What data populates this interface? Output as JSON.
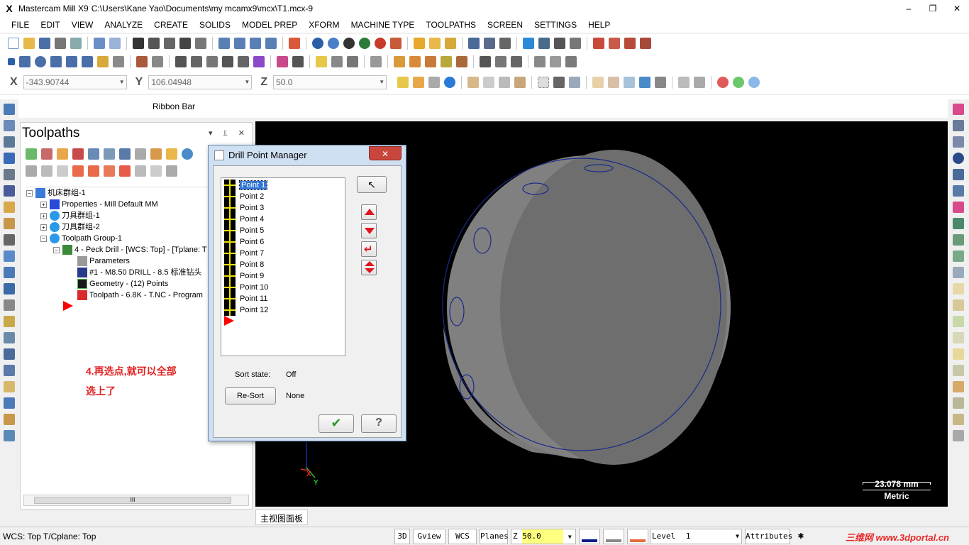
{
  "titlebar": {
    "app_name": "Mastercam Mill X9",
    "path": "C:\\Users\\Kane Yao\\Documents\\my mcamx9\\mcx\\T1.mcx-9",
    "minimize": "–",
    "restore": "❐",
    "close": "✕"
  },
  "menu": [
    "FILE",
    "EDIT",
    "VIEW",
    "ANALYZE",
    "CREATE",
    "SOLIDS",
    "MODEL PREP",
    "XFORM",
    "MACHINE TYPE",
    "TOOLPATHS",
    "SCREEN",
    "SETTINGS",
    "HELP"
  ],
  "coords": {
    "x_label": "X",
    "x_value": "-343.90744",
    "y_label": "Y",
    "y_value": "106.04948",
    "z_label": "Z",
    "z_value": "50.0"
  },
  "ribbon_bar": "Ribbon Bar",
  "toolpaths": {
    "title": "Toolpaths",
    "controls": "▾ ⫫ ✕",
    "tree": [
      {
        "label": "机床群组-1",
        "expander": "−"
      },
      {
        "label": "Properties - Mill Default MM",
        "expander": "+"
      },
      {
        "label": "刀具群组-1",
        "expander": "+"
      },
      {
        "label": "刀具群组-2",
        "expander": "+"
      },
      {
        "label": "Toolpath Group-1",
        "expander": "−"
      },
      {
        "label": "4 - Peck Drill - [WCS: Top] - [Tplane: T",
        "expander": "−"
      },
      {
        "label": "Parameters",
        "expander": ""
      },
      {
        "label": "#1 - M8.50 DRILL - 8.5 标准钻头",
        "expander": ""
      },
      {
        "label": "Geometry - (12) Points",
        "expander": ""
      },
      {
        "label": "Toolpath - 6.8K - T.NC - Program",
        "expander": ""
      }
    ],
    "annotation_line1": "4.再选点,就可以全部",
    "annotation_line2": "选上了",
    "scroll_thumb": "III"
  },
  "dialog": {
    "title": "Drill Point Manager",
    "close": "✕",
    "points": [
      "Point 1",
      "Point 2",
      "Point 3",
      "Point 4",
      "Point 5",
      "Point 6",
      "Point 7",
      "Point 8",
      "Point 9",
      "Point 10",
      "Point 11",
      "Point 12"
    ],
    "selected_point": "Point 1",
    "sort_state_label": "Sort state:",
    "sort_state_value": "Off",
    "resort_button": "Re-Sort",
    "resort_value": "None",
    "ok_icon": "✔",
    "help_icon": "?"
  },
  "viewport": {
    "scale_value": "23.078 mm",
    "scale_unit": "Metric",
    "axis_x": "X",
    "axis_y": "Y",
    "tab_label": "主视图面板"
  },
  "statusbar": {
    "text": "WCS: Top  T/Cplane: Top",
    "btn_3d": "3D",
    "btn_gview": "Gview",
    "btn_wcs": "WCS",
    "btn_planes": "Planes",
    "z_label": "Z",
    "z_value": "50.0",
    "level_label": "Level",
    "level_value": "1",
    "attributes": "Attributes",
    "watermark": "三维网 www.3dportal.cn"
  },
  "colors": {
    "accent_red": "#e0141e",
    "selection_blue": "#3375d6",
    "viewport_bg": "#000000",
    "point_yellow": "#e8e000"
  }
}
